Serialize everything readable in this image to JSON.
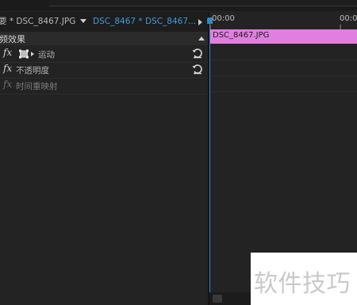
{
  "tabs": {
    "master_label": "要 * DSC_8467.JPG",
    "sequence_label": "DSC_8467 * DSC_8467..."
  },
  "effects": {
    "section_title": "频效果",
    "fx_symbol": "fx",
    "items": [
      {
        "label": "运动",
        "has_reset": true,
        "enabled": true
      },
      {
        "label": "不透明度",
        "has_reset": true,
        "enabled": true
      },
      {
        "label": "时间重映射",
        "has_reset": false,
        "enabled": false
      }
    ]
  },
  "timeline": {
    "timecode_start": "00:00",
    "timecode_end": "00:00",
    "clip_name": "DSC_8467.JPG",
    "clip_color": "#e07fdf",
    "playhead_color": "#2f88c9"
  },
  "watermark": {
    "text": "软件技巧"
  }
}
